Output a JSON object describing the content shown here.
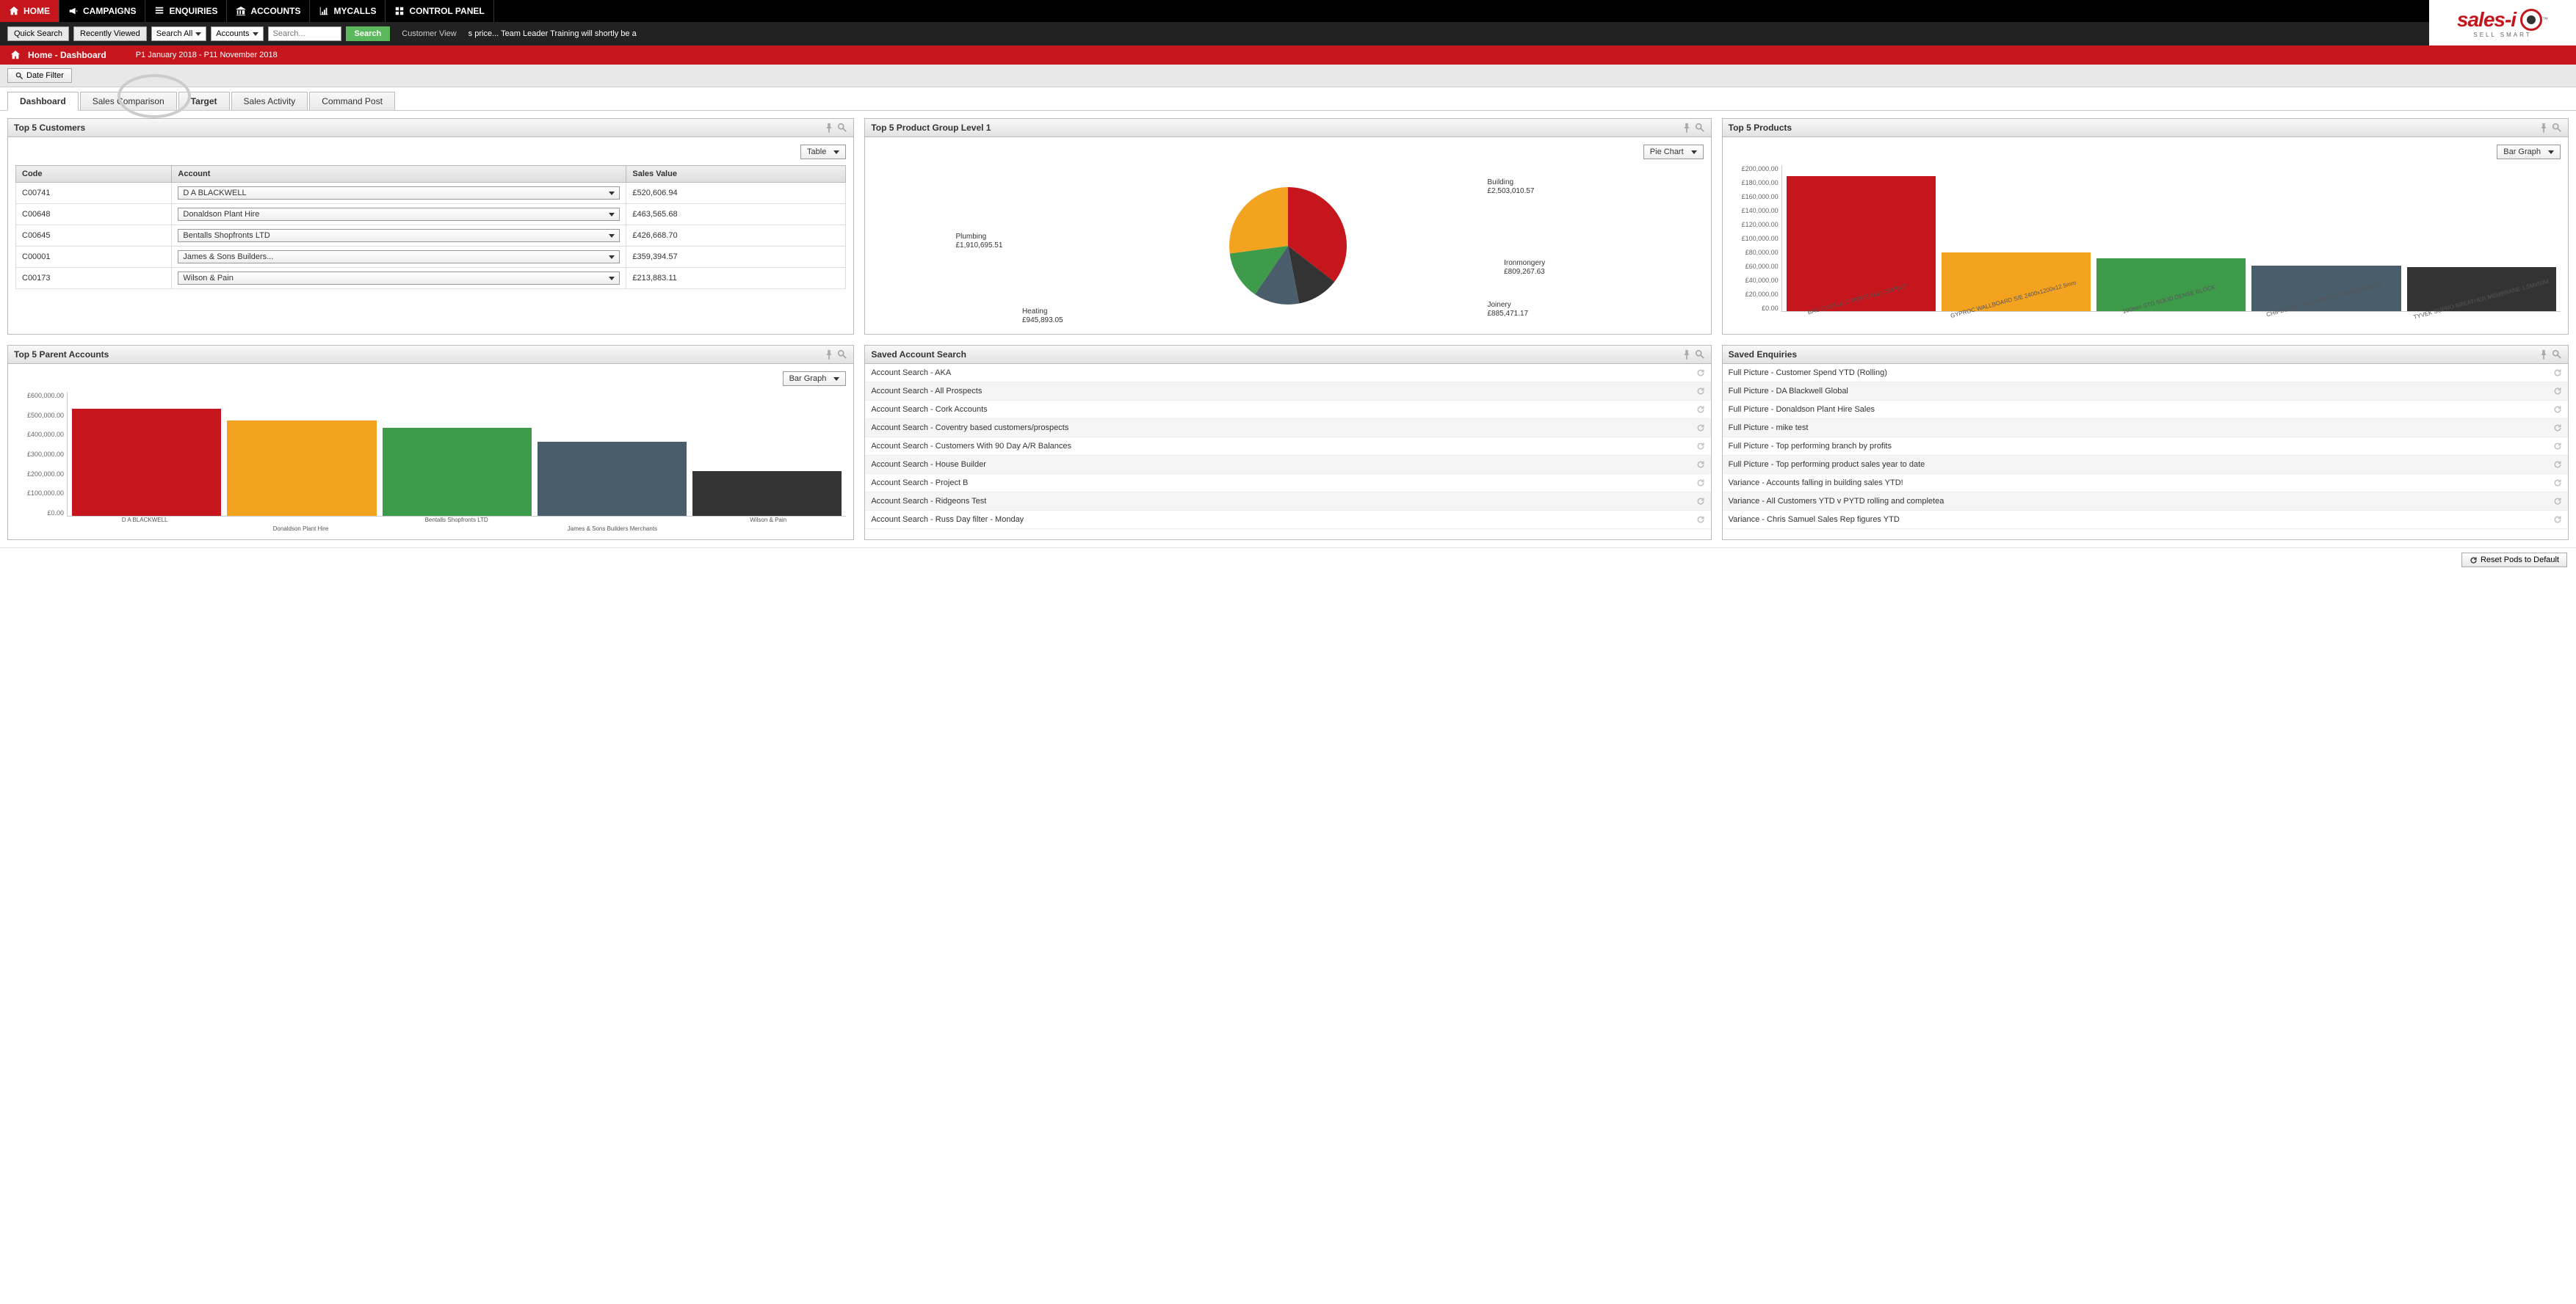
{
  "nav": {
    "items": [
      {
        "label": "HOME",
        "icon": "home"
      },
      {
        "label": "CAMPAIGNS",
        "icon": "megaphone"
      },
      {
        "label": "ENQUIRIES",
        "icon": "list"
      },
      {
        "label": "ACCOUNTS",
        "icon": "bank"
      },
      {
        "label": "MYCALLS",
        "icon": "chart"
      },
      {
        "label": "CONTROL PANEL",
        "icon": "grid"
      }
    ]
  },
  "secondbar": {
    "quick_search": "Quick Search",
    "recently_viewed": "Recently Viewed",
    "search_all": "Search All",
    "accounts": "Accounts",
    "search_placeholder": "Search...",
    "search_btn": "Search",
    "customer_view": "Customer View",
    "ticker": "s price... Team Leader Training will shortly be a"
  },
  "logo": {
    "brand": "sales-i",
    "tag": "SELL SMART",
    "tm": "™"
  },
  "redbar": {
    "title": "Home - Dashboard",
    "period": "P1 January 2018 - P11 November 2018"
  },
  "filter": {
    "date_filter": "Date Filter"
  },
  "tabs": {
    "items": [
      "Dashboard",
      "Sales Comparison",
      "Target",
      "Sales Activity",
      "Command Post"
    ],
    "highlighted": "Target"
  },
  "pods": {
    "customers": {
      "title": "Top 5 Customers",
      "view": "Table",
      "columns": [
        "Code",
        "Account",
        "Sales Value"
      ],
      "rows": [
        {
          "code": "C00741",
          "account": "D A BLACKWELL",
          "value": "£520,606.94"
        },
        {
          "code": "C00648",
          "account": "Donaldson Plant Hire",
          "value": "£463,565.68"
        },
        {
          "code": "C00645",
          "account": "Bentalls Shopfronts LTD",
          "value": "£426,668.70"
        },
        {
          "code": "C00001",
          "account": "James & Sons Builders...",
          "value": "£359,394.57"
        },
        {
          "code": "C00173",
          "account": "Wilson & Pain",
          "value": "£213,883.11"
        }
      ]
    },
    "product_group": {
      "title": "Top 5 Product Group Level 1",
      "view": "Pie Chart"
    },
    "products": {
      "title": "Top 5 Products",
      "view": "Bar Graph"
    },
    "parent_accounts": {
      "title": "Top 5 Parent Accounts",
      "view": "Bar Graph"
    },
    "saved_account": {
      "title": "Saved Account Search",
      "items": [
        "Account Search - AKA",
        "Account Search - All Prospects",
        "Account Search - Cork Accounts",
        "Account Search - Coventry based customers/prospects",
        "Account Search - Customers With 90 Day A/R Balances",
        "Account Search - House Builder",
        "Account Search - Project B",
        "Account Search - Ridgeons Test",
        "Account Search - Russ Day filter - Monday"
      ]
    },
    "saved_enquiries": {
      "title": "Saved Enquiries",
      "items": [
        "Full Picture - Customer Spend YTD (Rolling)",
        "Full Picture - DA Blackwell Global",
        "Full Picture - Donaldson Plant Hire Sales",
        "Full Picture - mike test",
        "Full Picture - Top performing branch by profits",
        "Full Picture - Top performing product sales year to date",
        "Variance - Accounts falling in building sales YTD!",
        "Variance - All Customers YTD v PYTD rolling and completea",
        "Variance - Chris Samuel Sales Rep figures YTD"
      ]
    }
  },
  "footer": {
    "reset": "Reset Pods to Default"
  },
  "chart_data": [
    {
      "id": "product_group_pie",
      "type": "pie",
      "title": "Top 5 Product Group Level 1",
      "series": [
        {
          "name": "Building",
          "value": 2503010.57,
          "label": "£2,503,010.57",
          "color": "#c4161c"
        },
        {
          "name": "Ironmongery",
          "value": 809267.63,
          "label": "£809,267.63",
          "color": "#333333"
        },
        {
          "name": "Joinery",
          "value": 885471.17,
          "label": "£885,471.17",
          "color": "#4a5d6b"
        },
        {
          "name": "Heating",
          "value": 945893.05,
          "label": "£945,893.05",
          "color": "#3d9b4a"
        },
        {
          "name": "Plumbing",
          "value": 1910695.51,
          "label": "£1,910,695.51",
          "color": "#f4a321"
        }
      ]
    },
    {
      "id": "products_bar",
      "type": "bar",
      "title": "Top 5 Products",
      "categories": [
        "BAG CASTLE O/PORTLAND CEMENT",
        "GYPROC WALLBOARD S/E 2400x1200x12.5mm",
        "100mm STD SOLID DENSE BLOCK",
        "CHIPBOARD T&G (M/R) P5 2400x600x18mm",
        "TYVEK SUPRO BREATHER MEMBRANE 1.5Mx50M"
      ],
      "values": [
        185000,
        80000,
        72000,
        62000,
        60000
      ],
      "colors": [
        "#c4161c",
        "#f4a321",
        "#3d9b4a",
        "#4a5d6b",
        "#333333"
      ],
      "ylim": [
        0,
        200000
      ],
      "yticks": [
        "£200,000.00",
        "£180,000.00",
        "£160,000.00",
        "£140,000.00",
        "£120,000.00",
        "£100,000.00",
        "£80,000.00",
        "£60,000.00",
        "£40,000.00",
        "£20,000.00",
        "£0.00"
      ]
    },
    {
      "id": "parent_accounts_bar",
      "type": "bar",
      "title": "Top 5 Parent Accounts",
      "categories": [
        "D A BLACKWELL",
        "Donaldson Plant Hire",
        "Bentalls Shopfronts LTD",
        "James & Sons Builders Merchants",
        "Wilson & Pain"
      ],
      "values": [
        520000,
        460000,
        425000,
        360000,
        215000
      ],
      "colors": [
        "#c4161c",
        "#f4a321",
        "#3d9b4a",
        "#4a5d6b",
        "#333333"
      ],
      "ylim": [
        0,
        600000
      ],
      "yticks": [
        "£600,000.00",
        "£500,000.00",
        "£400,000.00",
        "£300,000.00",
        "£200,000.00",
        "£100,000.00",
        "£0.00"
      ]
    }
  ]
}
